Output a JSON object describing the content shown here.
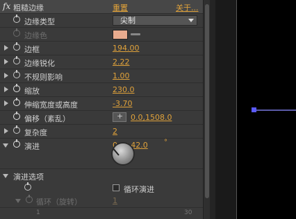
{
  "effect": {
    "fx_label": "fx",
    "name": "粗糙边缘",
    "reset_label": "重置",
    "about_label": "关于..."
  },
  "properties": [
    {
      "id": "edge_type",
      "label": "边缘类型",
      "value": "尖制",
      "kind": "dropdown"
    },
    {
      "id": "edge_color",
      "label": "边缘色",
      "color": "#e8ab8e",
      "kind": "color",
      "disabled": true
    },
    {
      "id": "border",
      "label": "边框",
      "value": "194.00"
    },
    {
      "id": "edge_sharpness",
      "label": "边缘锐化",
      "value": "2.22"
    },
    {
      "id": "fractal_influence",
      "label": "不规则影响",
      "value": "1.00"
    },
    {
      "id": "scale",
      "label": "缩放",
      "value": "230.0"
    },
    {
      "id": "stretch",
      "label": "伸缩宽度或高度",
      "value": "-3.70"
    },
    {
      "id": "offset",
      "label": "偏移（紊乱）",
      "value": "0.0,1508.0",
      "kind": "point"
    },
    {
      "id": "complexity",
      "label": "复杂度",
      "value": "2"
    },
    {
      "id": "evolution",
      "label": "演进",
      "value": "0x +42.0",
      "unit": "°"
    }
  ],
  "evolution_options": {
    "label": "演进选项",
    "cycle_checkbox_label": "循环演进",
    "cycle_checked": false,
    "cycle_label": "循环（旋转）",
    "cycle_value": "1",
    "scale_min": "1",
    "scale_max": "30"
  }
}
